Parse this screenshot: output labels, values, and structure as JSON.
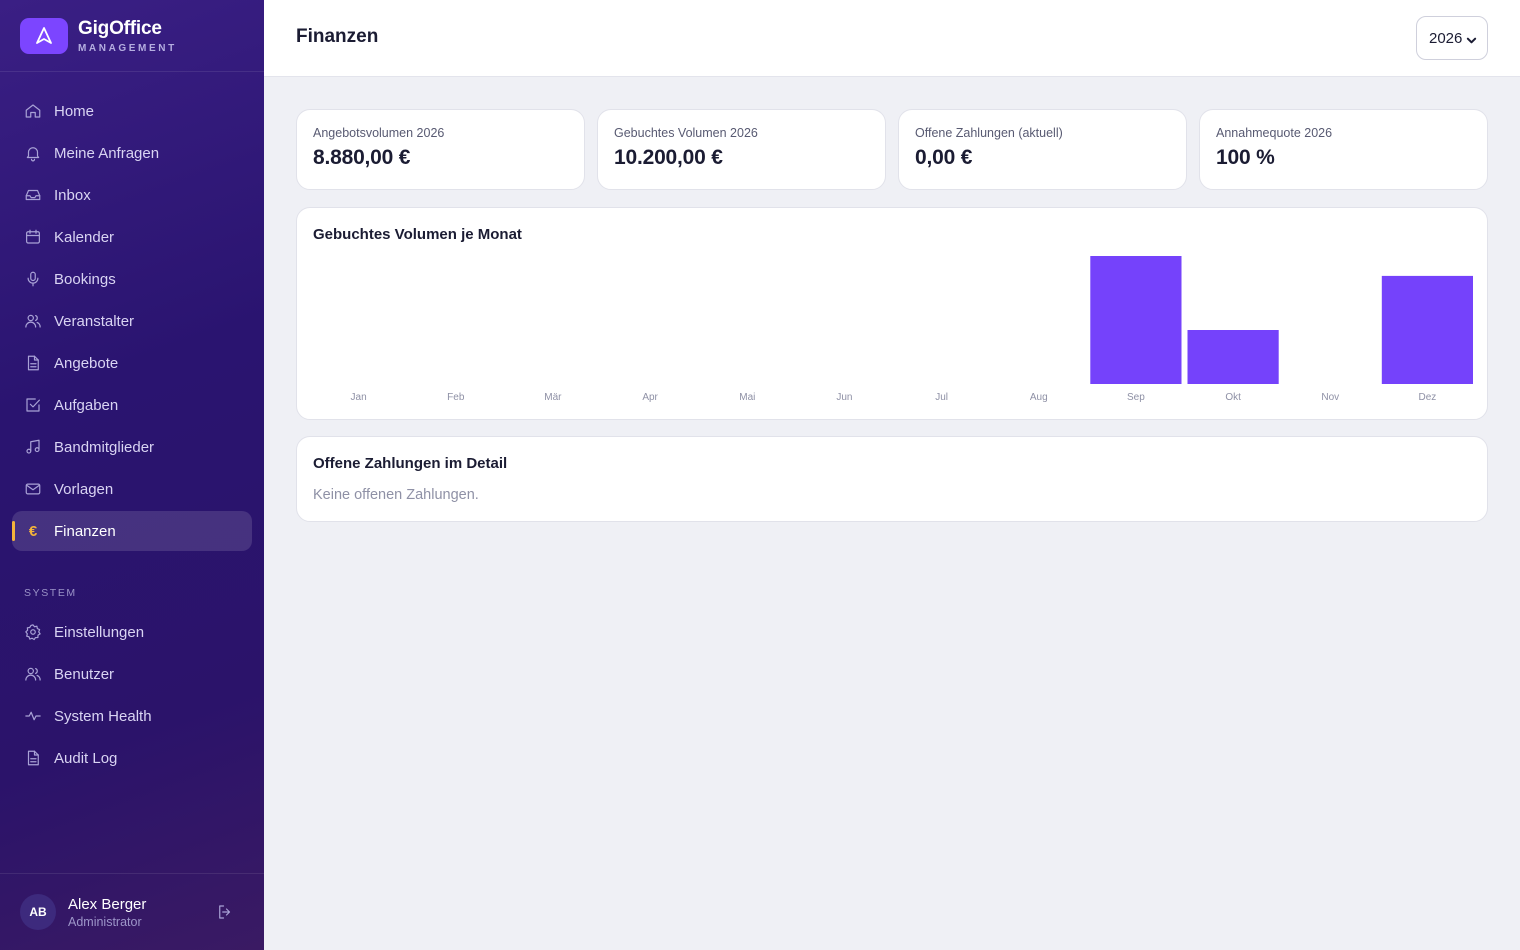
{
  "brand": {
    "name": "GigOffice",
    "subtitle": "MANAGEMENT"
  },
  "sidebar": {
    "items": [
      {
        "label": "Home",
        "icon": "home-icon"
      },
      {
        "label": "Meine Anfragen",
        "icon": "bell-icon"
      },
      {
        "label": "Inbox",
        "icon": "inbox-icon"
      },
      {
        "label": "Kalender",
        "icon": "calendar-icon"
      },
      {
        "label": "Bookings",
        "icon": "microphone-icon"
      },
      {
        "label": "Veranstalter",
        "icon": "users-icon"
      },
      {
        "label": "Angebote",
        "icon": "document-icon"
      },
      {
        "label": "Aufgaben",
        "icon": "checkbox-icon"
      },
      {
        "label": "Bandmitglieder",
        "icon": "music-note-icon"
      },
      {
        "label": "Vorlagen",
        "icon": "mail-icon"
      },
      {
        "label": "Finanzen",
        "icon": "euro-icon",
        "active": true,
        "glyph": "€"
      }
    ],
    "system_label": "SYSTEM",
    "system_items": [
      {
        "label": "Einstellungen",
        "icon": "gear-icon"
      },
      {
        "label": "Benutzer",
        "icon": "users-icon"
      },
      {
        "label": "System Health",
        "icon": "activity-icon"
      },
      {
        "label": "Audit Log",
        "icon": "document-icon"
      }
    ]
  },
  "user": {
    "initials": "AB",
    "name": "Alex Berger",
    "role": "Administrator"
  },
  "header": {
    "title": "Finanzen",
    "year_selected": "2026"
  },
  "kpis": [
    {
      "label": "Angebotsvolumen 2026",
      "value": "8.880,00 €"
    },
    {
      "label": "Gebuchtes Volumen 2026",
      "value": "10.200,00 €"
    },
    {
      "label": "Offene Zahlungen (aktuell)",
      "value": "0,00 €"
    },
    {
      "label": "Annahmequote 2026",
      "value": "100 %"
    }
  ],
  "chart_card": {
    "title": "Gebuchtes Volumen je Monat"
  },
  "chart_data": {
    "type": "bar",
    "title": "Gebuchtes Volumen je Monat",
    "categories": [
      "Jan",
      "Feb",
      "Mär",
      "Apr",
      "Mai",
      "Jun",
      "Jul",
      "Aug",
      "Sep",
      "Okt",
      "Nov",
      "Dez"
    ],
    "values": [
      0,
      0,
      0,
      0,
      0,
      0,
      0,
      0,
      4500,
      1900,
      0,
      3800
    ],
    "ylim": [
      0,
      4500
    ],
    "grid": false,
    "color": "#7542fb"
  },
  "detail_card": {
    "title": "Offene Zahlungen im Detail",
    "empty_text": "Keine offenen Zahlungen."
  },
  "colors": {
    "accent": "#7542fb",
    "active_marker": "#f4b43a",
    "sidebar_bg": "#2a1470"
  }
}
